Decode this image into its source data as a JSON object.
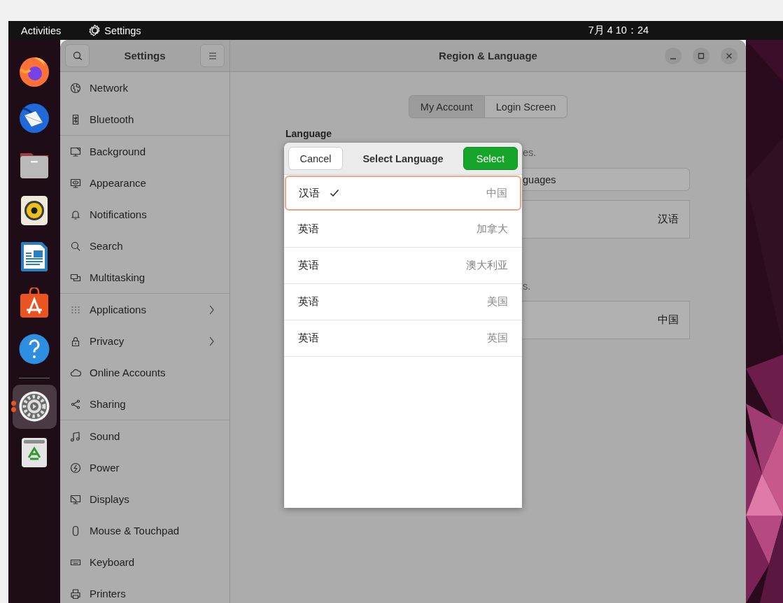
{
  "top_bar": {
    "activities": "Activities",
    "app_menu": "Settings",
    "clock": "7月 4 10：24"
  },
  "dock": [
    {
      "running": false
    },
    {
      "running": false
    },
    {
      "running": false
    },
    {
      "running": false
    },
    {
      "running": false
    },
    {
      "running": false
    },
    {
      "running": false
    },
    {
      "running": true
    },
    {
      "running": false
    }
  ],
  "sidebar": {
    "title": "Settings",
    "groups": [
      {
        "items": [
          {
            "label": "Network",
            "has_submenu": false
          },
          {
            "label": "Bluetooth",
            "has_submenu": false
          }
        ]
      },
      {
        "items": [
          {
            "label": "Background",
            "has_submenu": false
          },
          {
            "label": "Appearance",
            "has_submenu": false
          },
          {
            "label": "Notifications",
            "has_submenu": false
          },
          {
            "label": "Search",
            "has_submenu": false
          },
          {
            "label": "Multitasking",
            "has_submenu": false
          }
        ]
      },
      {
        "items": [
          {
            "label": "Applications",
            "has_submenu": true
          },
          {
            "label": "Privacy",
            "has_submenu": true
          },
          {
            "label": "Online Accounts",
            "has_submenu": false
          },
          {
            "label": "Sharing",
            "has_submenu": false
          }
        ]
      },
      {
        "items": [
          {
            "label": "Sound",
            "has_submenu": false
          },
          {
            "label": "Power",
            "has_submenu": false
          },
          {
            "label": "Displays",
            "has_submenu": false
          },
          {
            "label": "Mouse & Touchpad",
            "has_submenu": false
          },
          {
            "label": "Keyboard",
            "has_submenu": false
          },
          {
            "label": "Printers",
            "has_submenu": false
          }
        ]
      }
    ]
  },
  "window": {
    "title": "Region & Language"
  },
  "tabs": [
    {
      "label": "My Account",
      "selected": true
    },
    {
      "label": "Login Screen",
      "selected": false
    }
  ],
  "language_section": {
    "heading": "Language",
    "description": "es.",
    "button": "guages",
    "value": "汉语"
  },
  "formats_section": {
    "description": "s.",
    "value": "中国"
  },
  "dialog": {
    "cancel": "Cancel",
    "title": "Select Language",
    "select": "Select",
    "items": [
      {
        "language": "汉语",
        "region": "中国",
        "checked": true,
        "selected": true
      },
      {
        "language": "英语",
        "region": "加拿大",
        "checked": false,
        "selected": false
      },
      {
        "language": "英语",
        "region": "澳大利亚",
        "checked": false,
        "selected": false
      },
      {
        "language": "英语",
        "region": "美国",
        "checked": false,
        "selected": false
      },
      {
        "language": "英语",
        "region": "英国",
        "checked": false,
        "selected": false
      }
    ]
  }
}
